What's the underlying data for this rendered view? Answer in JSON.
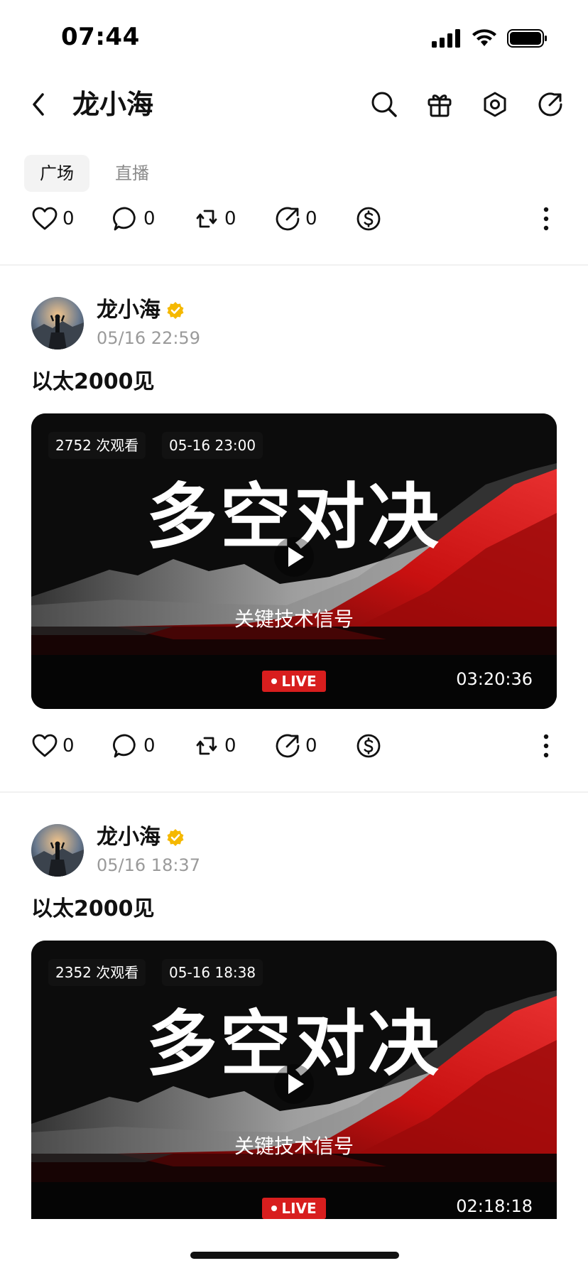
{
  "status_bar": {
    "time": "07:44"
  },
  "nav": {
    "title": "龙小海",
    "icons": [
      "back-icon",
      "search-icon",
      "gift-icon",
      "settings-icon",
      "share-icon"
    ]
  },
  "tabs": [
    {
      "label": "广场",
      "active": true
    },
    {
      "label": "直播",
      "active": false
    }
  ],
  "top_actions": {
    "like": "0",
    "comment": "0",
    "repost": "0",
    "share": "0"
  },
  "posts": [
    {
      "author": "龙小海",
      "verified": true,
      "time": "05/16 22:59",
      "text": "以太2000见",
      "video": {
        "views": "2752 次观看",
        "date": "05-16 23:00",
        "title": "多空对决",
        "subtitle": "关键技术信号",
        "live_label": "LIVE",
        "duration": "03:20:36"
      },
      "actions": {
        "like": "0",
        "comment": "0",
        "repost": "0",
        "share": "0"
      }
    },
    {
      "author": "龙小海",
      "verified": true,
      "time": "05/16 18:37",
      "text": "以太2000见",
      "video": {
        "views": "2352 次观看",
        "date": "05-16 18:38",
        "title": "多空对决",
        "subtitle": "关键技术信号",
        "live_label": "LIVE",
        "duration": "02:18:18"
      }
    }
  ],
  "colors": {
    "accent_live": "#d81e1e",
    "verified": "#f5b800",
    "muted": "#9a9a9a"
  }
}
